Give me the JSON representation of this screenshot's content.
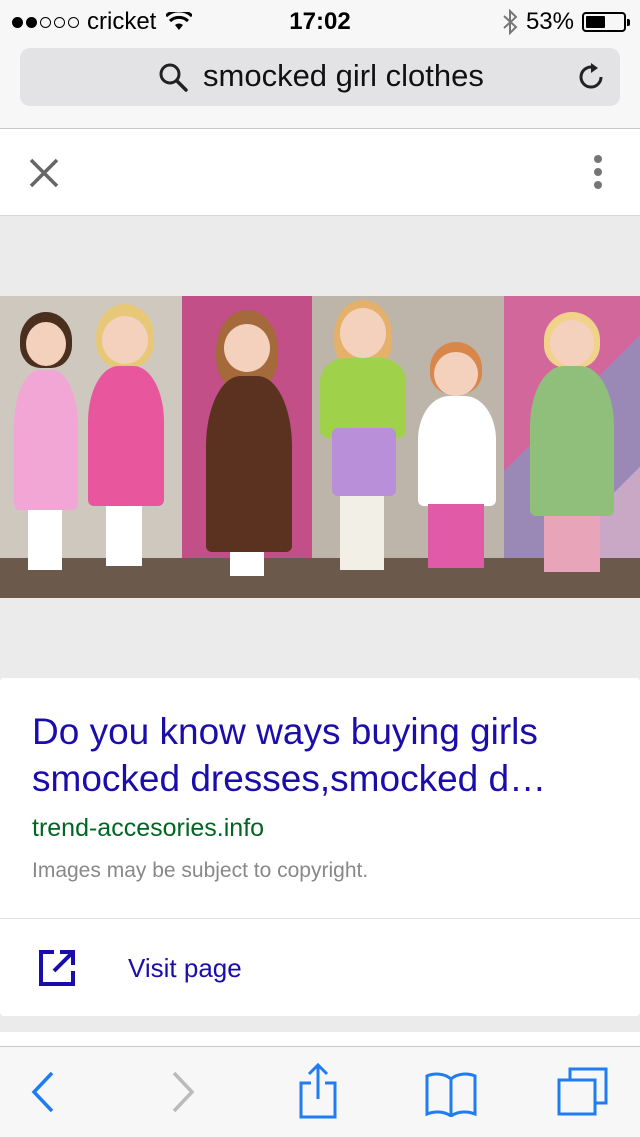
{
  "status": {
    "carrier": "cricket",
    "time": "17:02",
    "battery": "53%",
    "battery_level": 0.53,
    "signal_bars": 2
  },
  "search": {
    "query": "smocked girl clothes"
  },
  "result": {
    "title_line1": "Do you know ways buying girls",
    "title_line2": "smocked dresses,smocked d…",
    "domain": "trend-accesories.info",
    "copyright": "Images may be subject to copyright.",
    "visit_label": "Visit page"
  },
  "icons": {
    "search": "search-icon",
    "reload": "reload-icon",
    "close": "close-icon",
    "more": "more-vert-icon",
    "open": "open-in-new-icon",
    "back": "back-chevron-icon",
    "forward": "forward-chevron-icon",
    "share": "share-icon",
    "bookmarks": "bookmarks-icon",
    "tabs": "tabs-icon"
  },
  "colors": {
    "link": "#1a0dab",
    "domain": "#006621",
    "accent": "#1f7cf2"
  }
}
